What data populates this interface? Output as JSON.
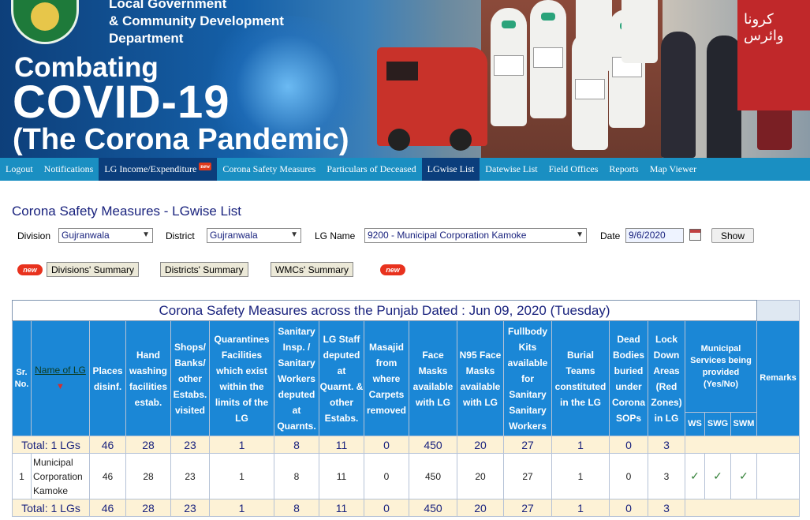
{
  "banner": {
    "dept_line1": "Local Government",
    "dept_line2": "& Community Development",
    "dept_line3": "Department",
    "title1": "Combating",
    "title2": "COVID-19",
    "title3": "(The Corona Pandemic)",
    "urdu_sign": "کرونا وائرس"
  },
  "nav": {
    "items": [
      {
        "label": "Logout"
      },
      {
        "label": "Notifications"
      },
      {
        "label": "LG Income/Expenditure",
        "badge": "new"
      },
      {
        "label": "Corona Safety Measures"
      },
      {
        "label": "Particulars of Deceased"
      },
      {
        "label": "LGwise List"
      },
      {
        "label": "Datewise List"
      },
      {
        "label": "Field Offices"
      },
      {
        "label": "Reports"
      },
      {
        "label": "Map Viewer"
      }
    ]
  },
  "page": {
    "heading": "Corona Safety Measures - LGwise List"
  },
  "filters": {
    "division_label": "Division",
    "division_value": "Gujranwala",
    "district_label": "District",
    "district_value": "Gujranwala",
    "lg_label": "LG Name",
    "lg_value": "9200 - Municipal Corporation Kamoke",
    "date_label": "Date",
    "date_value": "9/6/2020",
    "show_label": "Show"
  },
  "summaries": {
    "new_badge": "new",
    "divisions": "Divisions' Summary",
    "districts": "Districts' Summary",
    "wmcs": "WMCs' Summary"
  },
  "table": {
    "caption": "Corona Safety Measures across the Punjab Dated : Jun 09, 2020 (Tuesday)",
    "headers": {
      "sr": "Sr. No.",
      "name": "Name of LG",
      "places": "Places disinf.",
      "hand": "Hand washing facilities estab.",
      "shops": "Shops/ Banks/ other Estabs. visited",
      "quarantines": "Quarantines Facilities which exist within the limits of the LG",
      "sanitary": "Sanitary Insp. / Sanitary Workers deputed at Quarnts.",
      "lgstaff": "LG Staff deputed at Quarnt. & other Estabs.",
      "masajid": "Masajid from where Carpets removed",
      "facemasks": "Face Masks available with LG",
      "n95": "N95 Face Masks available with LG",
      "fullbody": "Fullbody Kits available for Sanitary Sanitary Workers",
      "burial": "Burial Teams constituted in the LG",
      "dead": "Dead Bodies buried under Corona SOPs",
      "lockdown": "Lock Down Areas (Red Zones) in LG",
      "municipal": "Municipal Services being provided (Yes/No)",
      "ws": "WS",
      "swg": "SWG",
      "swm": "SWM",
      "remarks": "Remarks"
    },
    "total_label": "Total: 1 LGs",
    "totals": [
      "46",
      "28",
      "23",
      "1",
      "8",
      "11",
      "0",
      "450",
      "20",
      "27",
      "1",
      "0",
      "3"
    ],
    "rows": [
      {
        "sr": "1",
        "name": "Municipal Corporation Kamoke",
        "values": [
          "46",
          "28",
          "23",
          "1",
          "8",
          "11",
          "0",
          "450",
          "20",
          "27",
          "1",
          "0",
          "3"
        ],
        "ws": "✓",
        "swg": "✓",
        "swm": "✓",
        "remarks": ""
      }
    ]
  },
  "colors": {
    "nav_bg": "#1a8fc2",
    "nav_active": "#0b3e7c",
    "header_bg": "#1b87d6",
    "total_bg": "#fdf2d6",
    "heading": "#1a237e"
  }
}
